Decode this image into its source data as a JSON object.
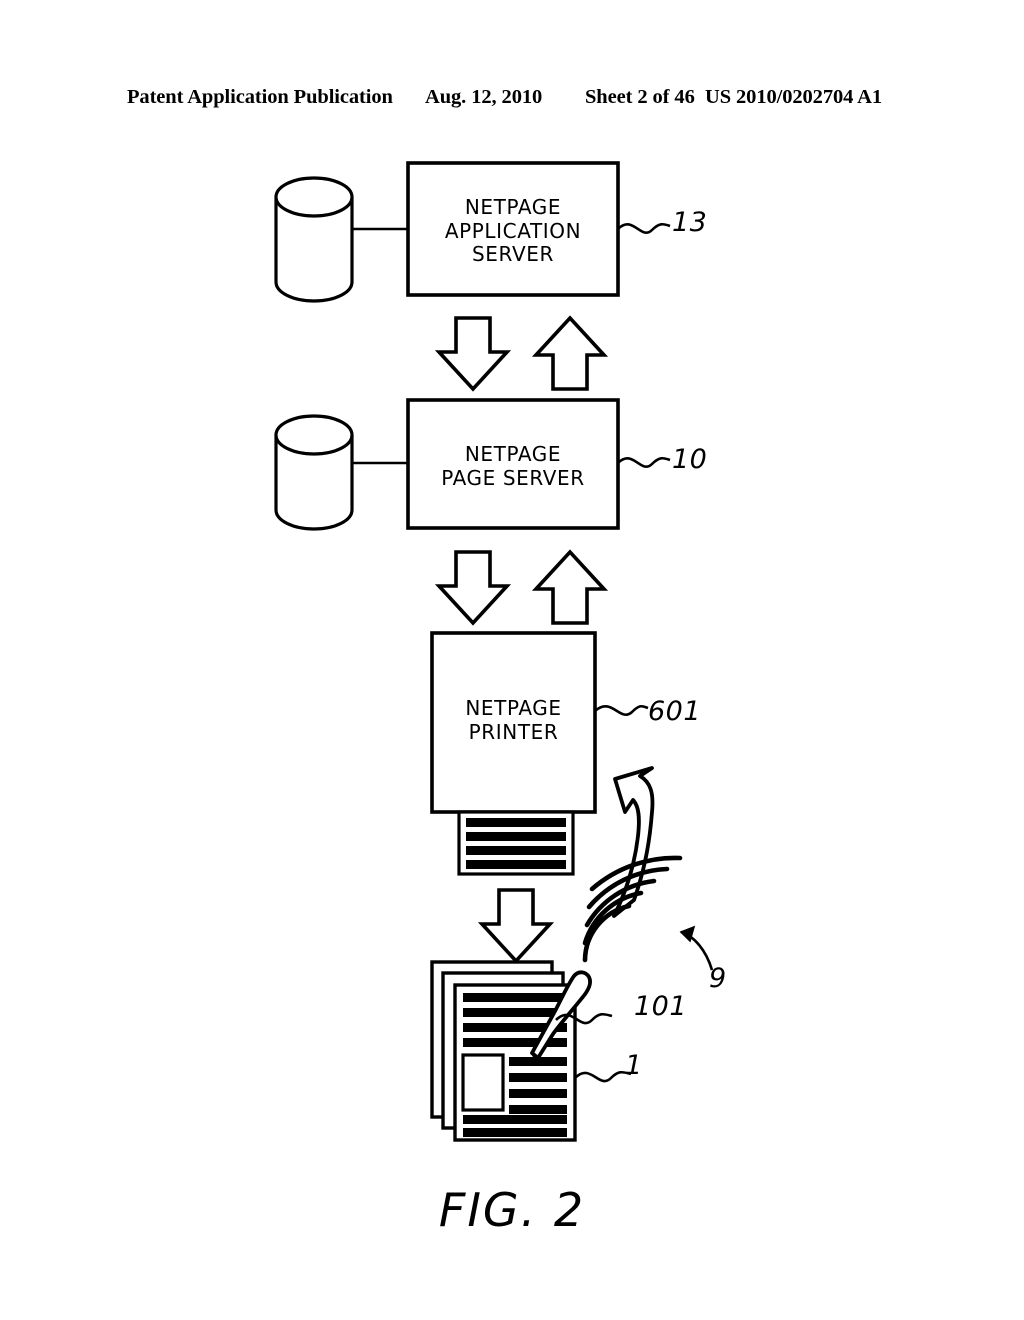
{
  "header": {
    "publication": "Patent Application Publication",
    "date": "Aug. 12, 2010",
    "sheet": "Sheet 2 of 46",
    "patent_number": "US 2010/0202704 A1"
  },
  "figure": {
    "caption": "FIG. 2"
  },
  "diagram": {
    "type": "block-diagram",
    "description": "Netpage system architecture showing application server, page server, printer, printed pages and netpage pen",
    "nodes": [
      {
        "id": "app-server",
        "label": "NETPAGE\nAPPLICATION\nSERVER",
        "ref": "13",
        "shape": "rectangle",
        "attached_storage": "database-cylinder"
      },
      {
        "id": "page-server",
        "label": "NETPAGE\nPAGE SERVER",
        "ref": "10",
        "shape": "rectangle",
        "attached_storage": "database-cylinder"
      },
      {
        "id": "printer",
        "label": "NETPAGE\nPRINTER",
        "ref": "601",
        "shape": "rectangle",
        "output": "printed-page"
      },
      {
        "id": "documents",
        "label": "",
        "ref": "1",
        "shape": "page-stack"
      },
      {
        "id": "pen",
        "label": "",
        "ref": "101",
        "shape": "stylus"
      },
      {
        "id": "wireless-signal",
        "label": "",
        "ref": "9",
        "shape": "radiating-arcs"
      }
    ],
    "connectors": [
      {
        "from": "app-server",
        "to": "page-server",
        "style": "bidirectional-block-arrows"
      },
      {
        "from": "page-server",
        "to": "printer",
        "style": "bidirectional-block-arrows"
      },
      {
        "from": "printer",
        "to": "documents",
        "style": "down-block-arrow"
      },
      {
        "from": "pen",
        "to": "printer",
        "style": "curved-block-arrow"
      }
    ],
    "colors": {
      "stroke": "#000000",
      "fill": "#ffffff",
      "text_bar": "#000000"
    }
  }
}
